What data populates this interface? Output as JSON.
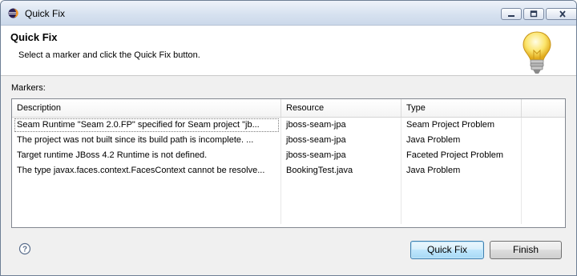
{
  "window": {
    "title": "Quick Fix",
    "icon": "eclipse-icon",
    "controls": {
      "minimize": "minimize-icon",
      "maximize": "maximize-icon",
      "close": "close-icon"
    }
  },
  "header": {
    "title": "Quick Fix",
    "description": "Select a marker and click the Quick Fix button.",
    "icon": "lightbulb-icon"
  },
  "markers": {
    "label": "Markers:",
    "columns": [
      "Description",
      "Resource",
      "Type"
    ],
    "rows": [
      {
        "description": "Seam Runtime \"Seam 2.0.FP\" specified for Seam project \"jb...",
        "resource": "jboss-seam-jpa",
        "type": "Seam Project Problem"
      },
      {
        "description": "The project was not built since its build path is incomplete. ...",
        "resource": "jboss-seam-jpa",
        "type": "Java Problem"
      },
      {
        "description": "Target runtime JBoss 4.2 Runtime is not defined.",
        "resource": "jboss-seam-jpa",
        "type": "Faceted Project Problem"
      },
      {
        "description": "The type javax.faces.context.FacesContext cannot be resolve...",
        "resource": "BookingTest.java",
        "type": "Java Problem"
      }
    ]
  },
  "footer": {
    "help_icon": "help-icon",
    "quick_fix_label": "Quick Fix",
    "finish_label": "Finish"
  },
  "colors": {
    "titlebar": "#d7e2f0",
    "default_button": "#bee6fd",
    "table_border": "#828790"
  }
}
